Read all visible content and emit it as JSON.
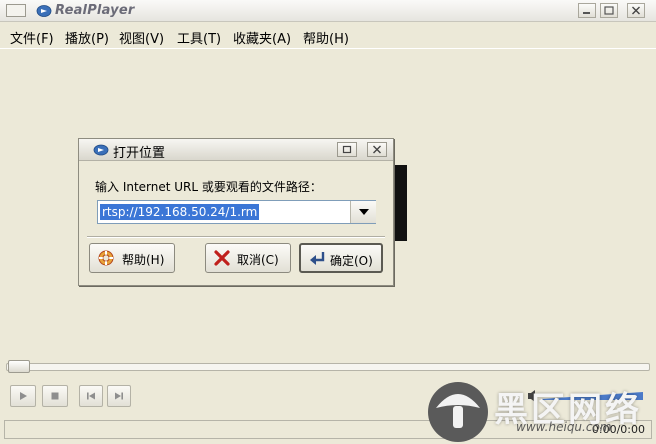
{
  "app": {
    "title": "RealPlayer"
  },
  "menu": {
    "items": [
      "文件(F)",
      "播放(P)",
      "视图(V)",
      "工具(T)",
      "收藏夹(A)",
      "帮助(H)"
    ]
  },
  "dialog": {
    "title": "打开位置",
    "prompt": "输入 Internet URL 或要观看的文件路径：",
    "url_value": "rtsp://192.168.50.24/1.rm",
    "help_label": "帮助(H)",
    "cancel_label": "取消(C)",
    "ok_label": "确定(O)"
  },
  "player": {
    "time": "0:00/0:00",
    "seek_position": 0
  },
  "watermark": {
    "text": "黑区网络",
    "url": "www.heiqu.com"
  },
  "colors": {
    "accent": "#3b76d6",
    "background": "#ece9d8",
    "watermark_circle": "#5a5a5a"
  },
  "icons": {
    "realplayer_logo": "realplayer-logo-icon",
    "help": "lifebuoy-icon",
    "cancel": "red-x-icon",
    "ok": "enter-arrow-icon"
  }
}
